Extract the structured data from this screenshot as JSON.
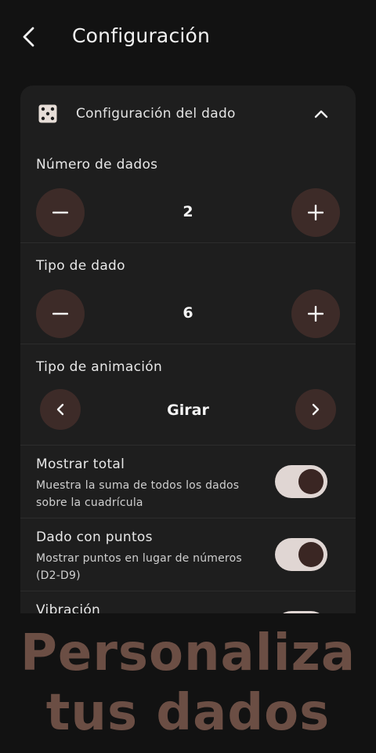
{
  "header": {
    "title": "Configuración"
  },
  "card": {
    "title": "Configuración del dado",
    "number_of_dice": {
      "label": "Número de dados",
      "value": "2"
    },
    "die_type": {
      "label": "Tipo de dado",
      "value": "6"
    },
    "animation_type": {
      "label": "Tipo de animación",
      "value": "Girar"
    },
    "toggles": [
      {
        "title": "Mostrar total",
        "description": "Muestra la suma de todos los dados sobre la cuadrícula",
        "on": true
      },
      {
        "title": "Dado con puntos",
        "description": "Mostrar puntos en lugar de números (D2-D9)",
        "on": true
      },
      {
        "title": "Vibración",
        "description": "",
        "on": true
      }
    ]
  },
  "promo": {
    "line1": "Personaliza",
    "line2": "tus dados"
  },
  "colors": {
    "background": "#121212",
    "card": "#1e1e1e",
    "button": "#3d2b28",
    "accent_text": "#6b4e44",
    "toggle_track": "#e0d6d3",
    "toggle_knob": "#3a2623"
  },
  "icons": {
    "back": "chevron-left-icon",
    "dice": "dice-five-icon",
    "collapse": "chevron-up-icon"
  }
}
